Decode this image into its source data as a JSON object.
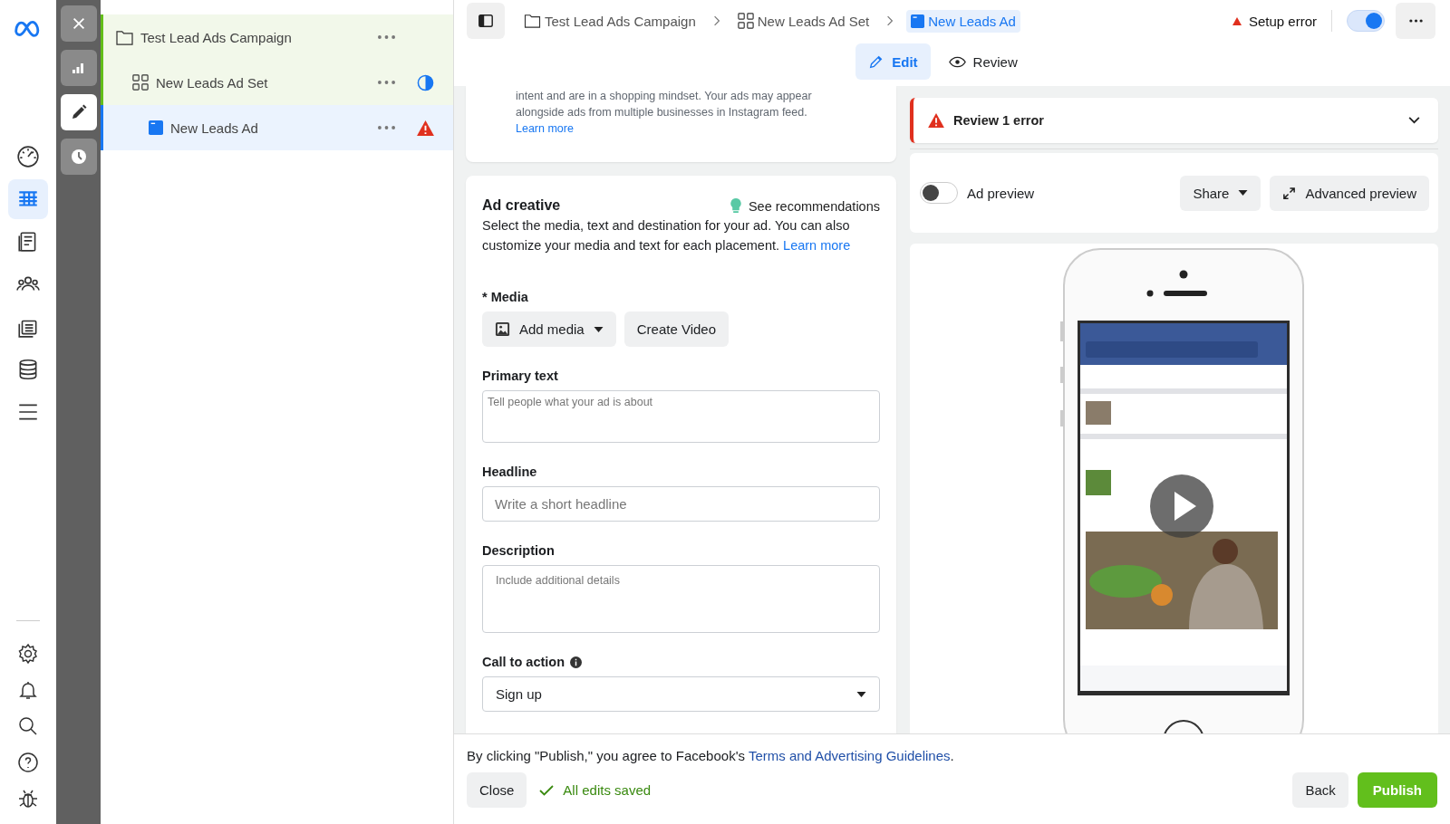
{
  "rail": {
    "top": [
      {
        "selected": false
      },
      {
        "selected": true
      },
      {
        "selected": false
      },
      {
        "selected": false
      },
      {
        "selected": false
      },
      {
        "selected": false
      },
      {
        "selected": false
      }
    ],
    "bottom": [
      {
        "selected": false
      },
      {
        "selected": false
      },
      {
        "selected": false
      },
      {
        "selected": false
      },
      {
        "selected": false
      }
    ]
  },
  "tool_strip": [
    {
      "selected": false
    },
    {
      "selected": true
    },
    {
      "selected": false
    }
  ],
  "tree": [
    {
      "label": "Test Lead Ads Campaign",
      "kind": "campaign",
      "selected": false,
      "in_progress": false,
      "error": false,
      "children": [
        {
          "label": "New Leads Ad Set",
          "kind": "adset",
          "selected": false,
          "in_progress": true,
          "error": false,
          "children": [
            {
              "label": "New Leads Ad",
              "kind": "ad",
              "selected": true,
              "in_progress": false,
              "error": true
            }
          ]
        }
      ]
    }
  ],
  "breadcrumbs": [
    {
      "label": "Test Lead Ads Campaign",
      "kind": "campaign",
      "selected": false
    },
    {
      "label": "New Leads Ad Set",
      "kind": "adset",
      "selected": false
    },
    {
      "label": "New Leads Ad",
      "kind": "ad",
      "selected": true
    }
  ],
  "status": {
    "text": "Setup error",
    "toggle_on": true
  },
  "tabs": [
    {
      "label": "Edit",
      "kind": "edit",
      "selected": true
    },
    {
      "label": "Review",
      "kind": "review",
      "selected": false
    }
  ],
  "placement_note": {
    "text": "intent and are in a shopping mindset. Your ads may appear alongside ads from multiple businesses in Instagram feed.",
    "link": "Learn more"
  },
  "ad_creative": {
    "title": "Ad creative",
    "recommendations": "See recommendations",
    "description": "Select the media, text and destination for your ad. You can also customize your media and text for each placement.",
    "link": "Learn more",
    "media": {
      "label": "* Media",
      "buttons": [
        "Add media",
        "Create Video"
      ]
    },
    "primary_text": {
      "label": "Primary text",
      "placeholder": "Tell people what your ad is about"
    },
    "headline": {
      "label": "Headline",
      "placeholder": "Write a short headline"
    },
    "description_field": {
      "label": "Description",
      "placeholder": "Include additional details"
    },
    "call_to_action": {
      "label": "Call to action",
      "value": "Sign up"
    }
  },
  "review": {
    "text": "Review 1 error"
  },
  "preview": {
    "toggle_on": false,
    "label": "Ad preview",
    "share": "Share",
    "advanced": "Advanced preview"
  },
  "footer": {
    "notice": "By clicking \"Publish,\" you agree to Facebook's",
    "link": "Terms and Advertising Guidelines",
    "notice_end": ".",
    "close": "Close",
    "saved": "All edits saved",
    "back": "Back",
    "publish": "Publish"
  }
}
